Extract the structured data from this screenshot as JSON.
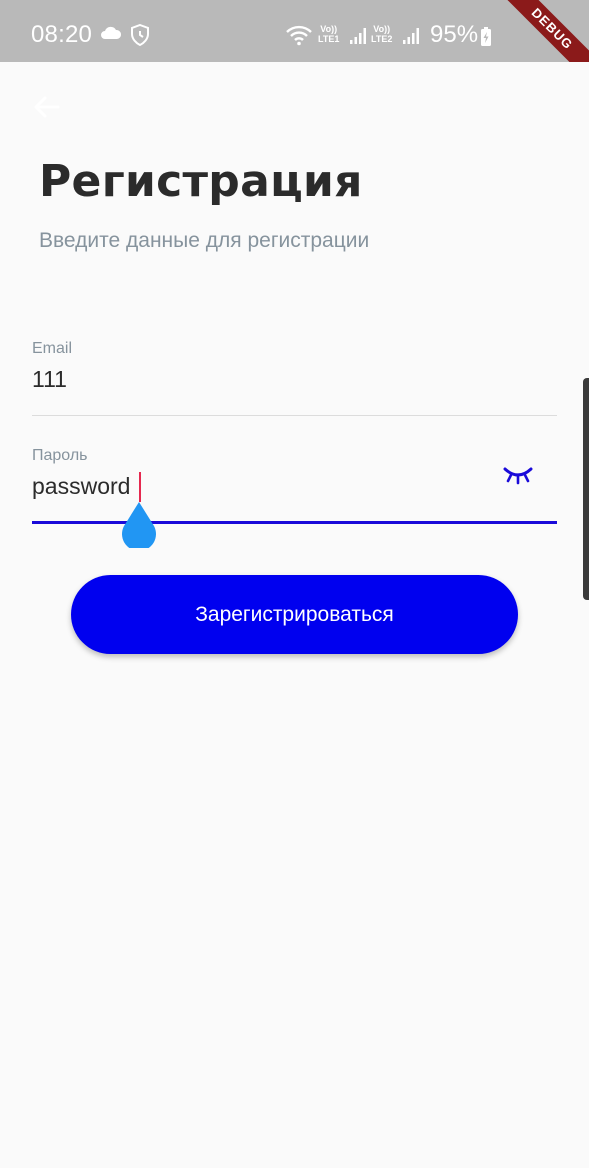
{
  "status_bar": {
    "time": "08:20",
    "lte1_top": "Vo))",
    "lte1_bottom": "LTE1",
    "lte2_top": "Vo))",
    "lte2_bottom": "LTE2",
    "battery": "95%",
    "debug_banner": "DEBUG"
  },
  "header": {
    "title": "Регистрация",
    "subtitle": "Введите данные для регистрации"
  },
  "form": {
    "email": {
      "label": "Email",
      "value": "111"
    },
    "password": {
      "label": "Пароль",
      "value": "password"
    }
  },
  "actions": {
    "register_label": "Зарегистрироваться"
  },
  "colors": {
    "accent": "#0000ef",
    "underline_active": "#1a0ad9",
    "caret": "#e5284f",
    "handle": "#2196f3",
    "label": "#86939d"
  },
  "icons": [
    "back-arrow-icon",
    "cloud-icon",
    "shield-icon",
    "wifi-icon",
    "signal-icon",
    "battery-icon",
    "eye-closed-icon",
    "text-cursor-handle-icon"
  ]
}
